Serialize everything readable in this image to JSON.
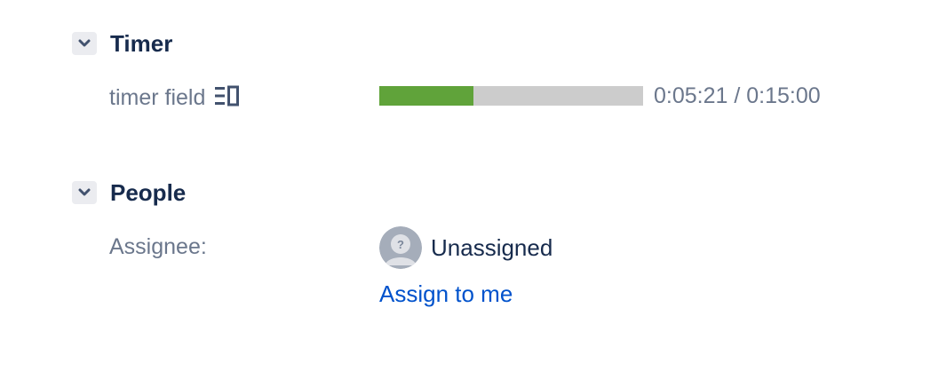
{
  "timer_section": {
    "title": "Timer",
    "toggle_icon": "chevron-down-icon",
    "field": {
      "label": "timer field",
      "label_icon": "column-view-icon",
      "progress_fraction": 0.357,
      "progress_color": "#60a33a",
      "track_color": "#cccccc",
      "value": "0:05:21 / 0:15:00"
    }
  },
  "people_section": {
    "title": "People",
    "toggle_icon": "chevron-down-icon",
    "assignee": {
      "label": "Assignee:",
      "avatar_icon": "unknown-user-avatar-icon",
      "name": "Unassigned",
      "assign_link": "Assign to me",
      "link_color": "#0052cc"
    }
  }
}
